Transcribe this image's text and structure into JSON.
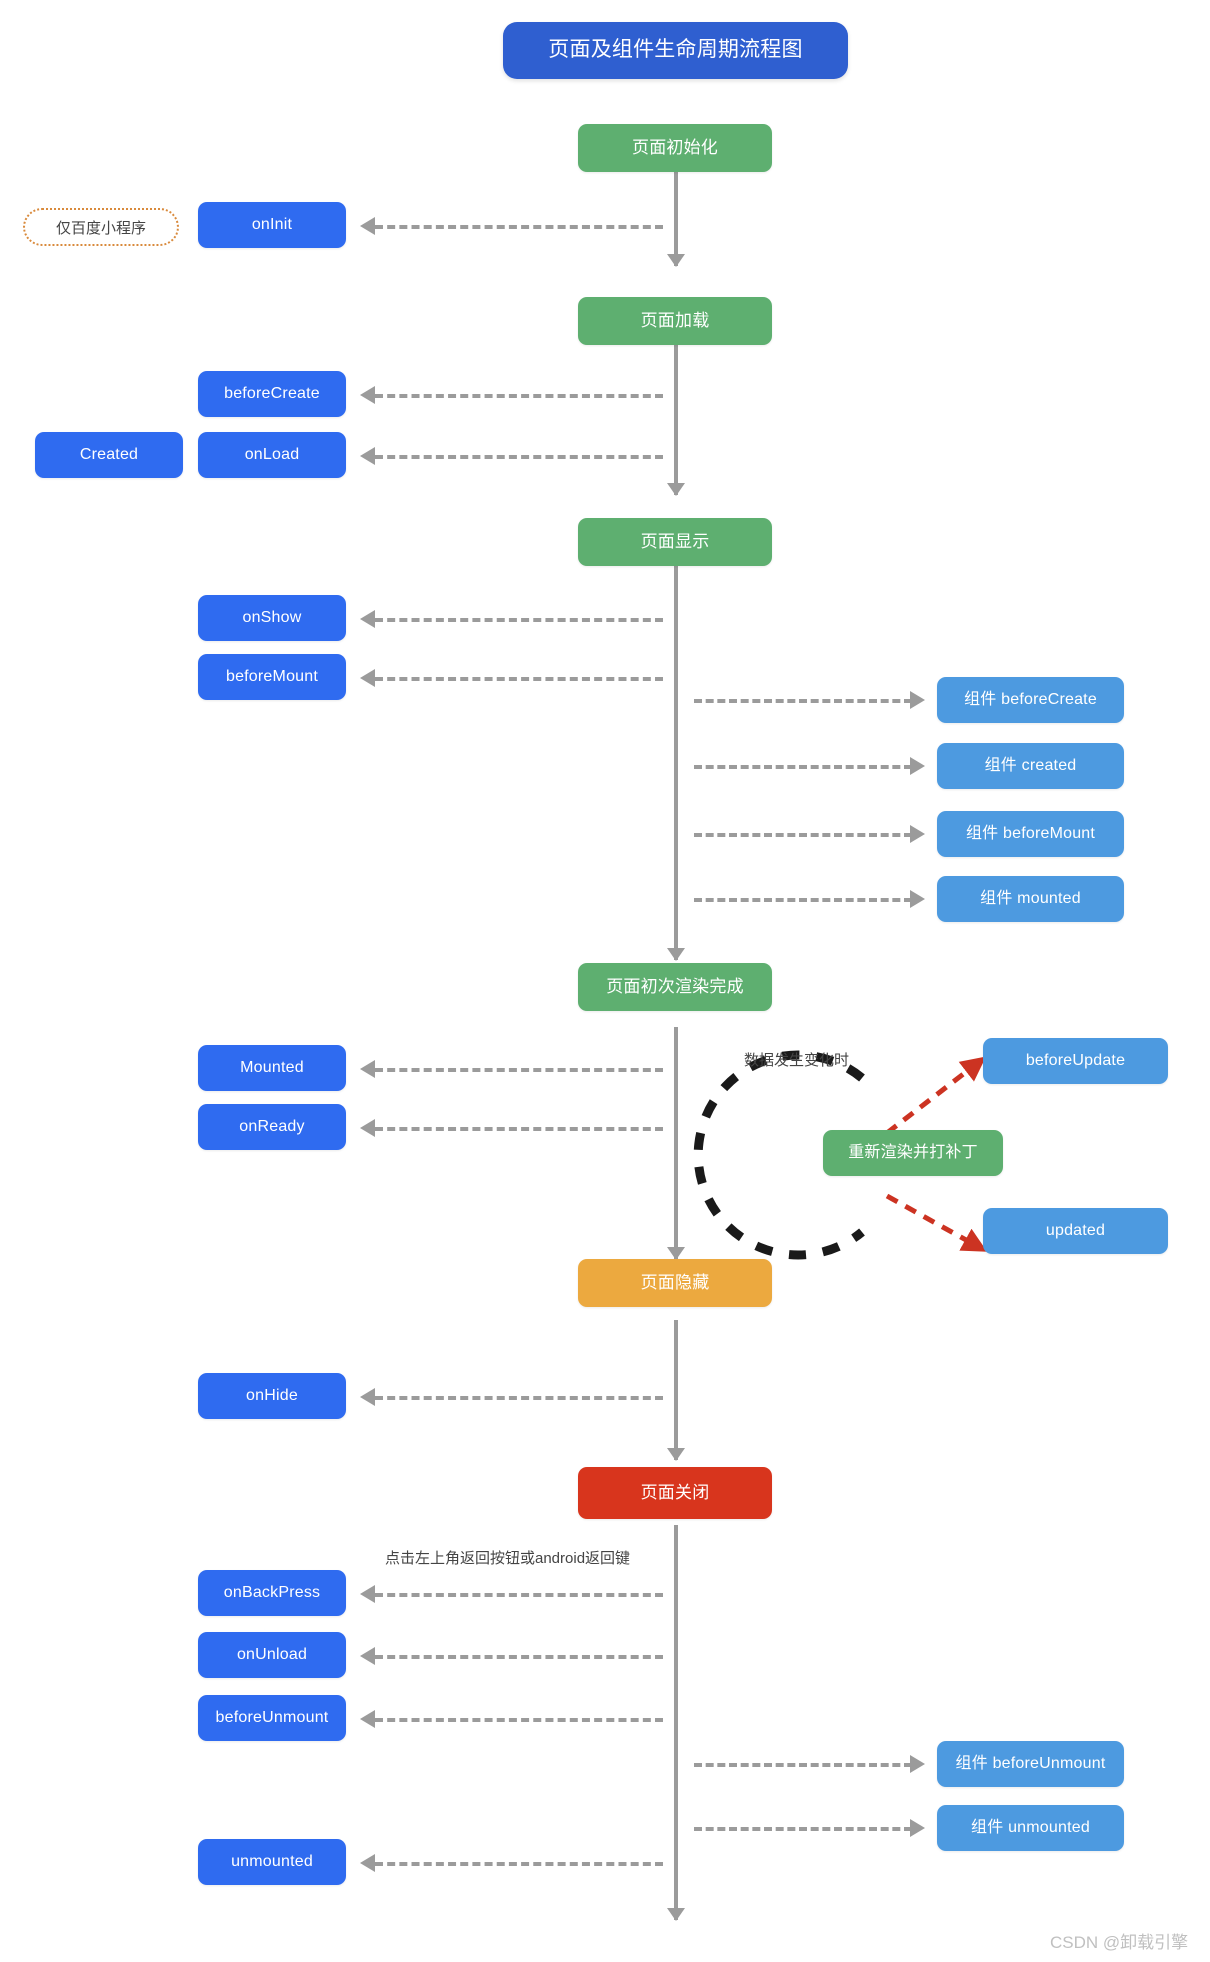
{
  "title": {
    "text": "页面及组件生命周期流程图"
  },
  "stages": [
    {
      "label": "页面初始化",
      "kind": "green"
    },
    {
      "label": "页面加载",
      "kind": "green"
    },
    {
      "label": "页面显示",
      "kind": "green"
    },
    {
      "label": "页面初次渲染完成",
      "kind": "green"
    },
    {
      "label": "页面隐藏",
      "kind": "orange"
    },
    {
      "label": "页面关闭",
      "kind": "red"
    }
  ],
  "page_hooks": [
    {
      "label": "onInit"
    },
    {
      "label": "beforeCreate"
    },
    {
      "label": "onLoad"
    },
    {
      "label": "onShow"
    },
    {
      "label": "beforeMount"
    },
    {
      "label": "Mounted"
    },
    {
      "label": "onReady"
    },
    {
      "label": "onHide"
    },
    {
      "label": "onBackPress"
    },
    {
      "label": "onUnload"
    },
    {
      "label": "beforeUnmount"
    },
    {
      "label": "unmounted"
    }
  ],
  "aliases": [
    {
      "label": "Created"
    }
  ],
  "badges": [
    {
      "label": "仅百度小程序"
    }
  ],
  "component_hooks": [
    {
      "label": "组件 beforeCreate"
    },
    {
      "label": "组件 created"
    },
    {
      "label": "组件 beforeMount"
    },
    {
      "label": "组件 mounted"
    },
    {
      "label": "组件 beforeUnmount"
    },
    {
      "label": "组件 unmounted"
    }
  ],
  "update_loop": {
    "note": "数据发生变化时",
    "render_box": "重新渲染并打补丁",
    "before_update": "beforeUpdate",
    "updated": "updated"
  },
  "notes": [
    {
      "label": "点击左上角返回按钮或android返回键"
    }
  ],
  "watermark": {
    "text": "CSDN @卸载引擎"
  },
  "colors": {
    "title_blue": "#2f5fd0",
    "stage_green": "#5eaf70",
    "stage_orange": "#eca93f",
    "stage_red": "#d8351d",
    "page_hook_blue": "#2f6bf0",
    "component_blue": "#4d9ae0",
    "connector_gray": "#9b9b9b",
    "loop_black": "#1a1a1a",
    "update_red": "#cc3322",
    "badge_border": "#d98a3c"
  }
}
